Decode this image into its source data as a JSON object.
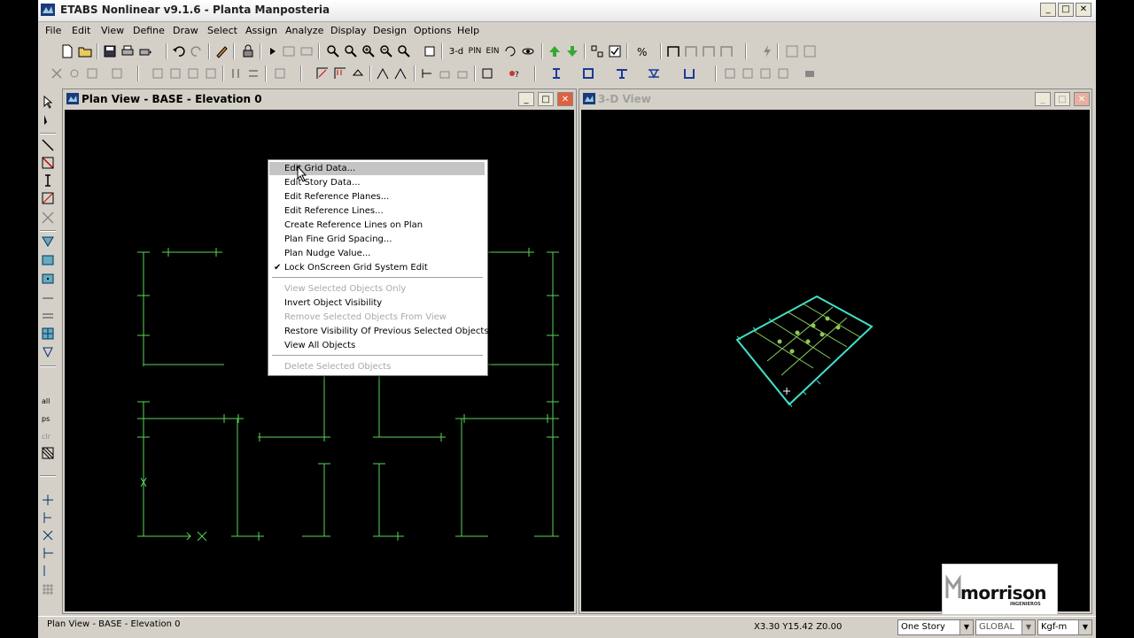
{
  "window": {
    "title": "ETABS Nonlinear v9.1.6 - Planta Manposteria",
    "buttons": {
      "minimize": "_",
      "maximize": "□",
      "close": "✕"
    }
  },
  "menubar": [
    "File",
    "Edit",
    "View",
    "Define",
    "Draw",
    "Select",
    "Assign",
    "Analyze",
    "Display",
    "Design",
    "Options",
    "Help"
  ],
  "toolbar": {
    "view_3d_label": "3-d",
    "plan_label": "PlN",
    "elev_label": "ElN"
  },
  "plan_view": {
    "title": "Plan View - BASE - Elevation 0",
    "grid_color": "#59d659"
  },
  "view_3d": {
    "title": "3-D View",
    "model_color": "#40e0c8"
  },
  "context_menu": {
    "items": [
      {
        "label": "Edit Grid Data...",
        "highlighted": true
      },
      {
        "label": "Edit Story Data..."
      },
      {
        "label": "Edit Reference Planes..."
      },
      {
        "label": "Edit Reference Lines..."
      },
      {
        "label": "Create Reference Lines on Plan"
      },
      {
        "label": "Plan Fine Grid Spacing..."
      },
      {
        "label": "Plan Nudge Value..."
      },
      {
        "label": "Lock OnScreen Grid System Edit",
        "checked": true
      }
    ],
    "items2": [
      {
        "label": "View Selected Objects Only",
        "disabled": true
      },
      {
        "label": "Invert Object Visibility"
      },
      {
        "label": "Remove Selected Objects From View",
        "disabled": true
      },
      {
        "label": "Restore Visibility Of Previous Selected Objects"
      },
      {
        "label": "View All Objects"
      }
    ],
    "items3": [
      {
        "label": "Delete Selected Objects",
        "disabled": true
      }
    ],
    "check_glyph": "✔"
  },
  "status": {
    "left": "Plan View - BASE - Elevation 0",
    "coords": "X3.30  Y15.42  Z0.00",
    "story": "One Story",
    "coord_system": "GLOBAL",
    "units": "Kgf-m"
  },
  "watermark": {
    "brand": "morrison",
    "sub": "INGENIEROS"
  }
}
